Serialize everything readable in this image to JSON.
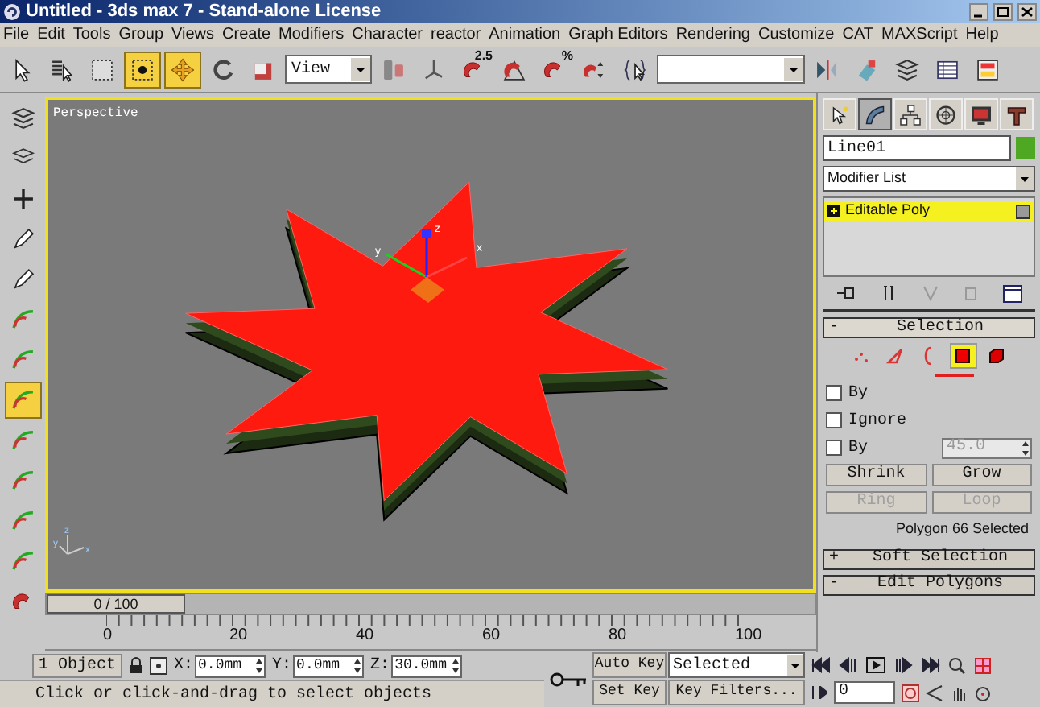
{
  "window": {
    "title": "Untitled - 3ds max 7  - Stand-alone License"
  },
  "menu": [
    "File",
    "Edit",
    "Tools",
    "Group",
    "Views",
    "Create",
    "Modifiers",
    "Character",
    "reactor",
    "Animation",
    "Graph Editors",
    "Rendering",
    "Customize",
    "CAT",
    "MAXScript",
    "Help"
  ],
  "toolbar": [
    {
      "kind": "select",
      "selected": false
    },
    {
      "kind": "list",
      "selected": false
    },
    {
      "kind": "region",
      "selected": false
    },
    {
      "kind": "crossing",
      "selected": true
    },
    {
      "kind": "move",
      "selected": true
    },
    {
      "kind": "rotate",
      "selected": false
    },
    {
      "kind": "scale",
      "selected": false
    },
    {
      "kind": "dropdown",
      "value": "View"
    },
    {
      "kind": "pivot",
      "selected": false
    },
    {
      "kind": "axes",
      "selected": false
    },
    {
      "kind": "magnet",
      "selected": false,
      "label": "2.5"
    },
    {
      "kind": "angle",
      "selected": false
    },
    {
      "kind": "magnet",
      "selected": false,
      "label": "%"
    },
    {
      "kind": "spinner",
      "selected": false
    },
    {
      "kind": "braces",
      "selected": false
    },
    {
      "kind": "combo"
    },
    {
      "kind": "mirror",
      "selected": false
    },
    {
      "kind": "align",
      "selected": false
    },
    {
      "kind": "layers",
      "selected": false
    },
    {
      "kind": "table",
      "selected": false
    },
    {
      "kind": "render",
      "selected": false
    }
  ],
  "left_tools": [
    {
      "kind": "layers",
      "selected": false
    },
    {
      "kind": "stack",
      "selected": false
    },
    {
      "kind": "plus",
      "selected": false
    },
    {
      "kind": "pen",
      "selected": false
    },
    {
      "kind": "pen",
      "selected": false
    },
    {
      "kind": "curve",
      "selected": false
    },
    {
      "kind": "curve",
      "selected": false
    },
    {
      "kind": "curve",
      "selected": true
    },
    {
      "kind": "curve",
      "selected": false
    },
    {
      "kind": "curve",
      "selected": false
    },
    {
      "kind": "curve",
      "selected": false
    },
    {
      "kind": "curve",
      "selected": false
    },
    {
      "kind": "magnet",
      "selected": false
    }
  ],
  "viewport": {
    "label": "Perspective",
    "gizmo_axes": [
      "y",
      "z",
      "x"
    ],
    "corner_axes": [
      "z",
      "y",
      "x"
    ]
  },
  "command_panel": {
    "tabs": [
      {
        "kind": "create",
        "selected": false
      },
      {
        "kind": "modify",
        "selected": true
      },
      {
        "kind": "hierarchy",
        "selected": false
      },
      {
        "kind": "motion",
        "selected": false
      },
      {
        "kind": "display",
        "selected": false
      },
      {
        "kind": "utilities",
        "selected": false
      }
    ],
    "object_name": "Line01",
    "modifier_list": "Modifier List",
    "stack": [
      {
        "label": "Editable Poly",
        "selected": true
      }
    ],
    "rollouts": [
      {
        "title": "Selection",
        "sign": "-",
        "expanded": true
      },
      {
        "title": "Soft Selection",
        "sign": "+",
        "expanded": false
      },
      {
        "title": "Edit Polygons",
        "sign": "-",
        "expanded": false
      }
    ],
    "subobjects": [
      {
        "kind": "vertex",
        "selected": false
      },
      {
        "kind": "edge",
        "selected": false
      },
      {
        "kind": "border",
        "selected": false
      },
      {
        "kind": "polygon",
        "selected": true
      },
      {
        "kind": "element",
        "selected": false
      }
    ],
    "checkboxes": [
      {
        "label": "By",
        "checked": false
      },
      {
        "label": "Ignore",
        "checked": false
      },
      {
        "label": "By",
        "checked": false,
        "value": "45.0",
        "disabled": true
      }
    ],
    "buttons": [
      {
        "label": "Shrink",
        "disabled": false
      },
      {
        "label": "Grow",
        "disabled": false
      },
      {
        "label": "Ring",
        "disabled": true
      },
      {
        "label": "Loop",
        "disabled": true
      }
    ],
    "status": "Polygon 66 Selected"
  },
  "time_slider": {
    "label": "0 / 100",
    "level": 0
  },
  "ruler": {
    "ticks": [
      "0",
      "20",
      "40",
      "60",
      "80",
      "100"
    ]
  },
  "status_bar": {
    "selection": "1 Object",
    "coords": [
      {
        "label": "X:",
        "value": "0.0mm"
      },
      {
        "label": "Y:",
        "value": "0.0mm"
      },
      {
        "label": "Z:",
        "value": "30.0mm"
      }
    ],
    "auto_key": "Auto Key",
    "key_mode": "Selected",
    "set_key": "Set Key",
    "key_filters": "Key Filters...",
    "frame": "0",
    "prompt": "Click or click-and-drag to select objects"
  }
}
